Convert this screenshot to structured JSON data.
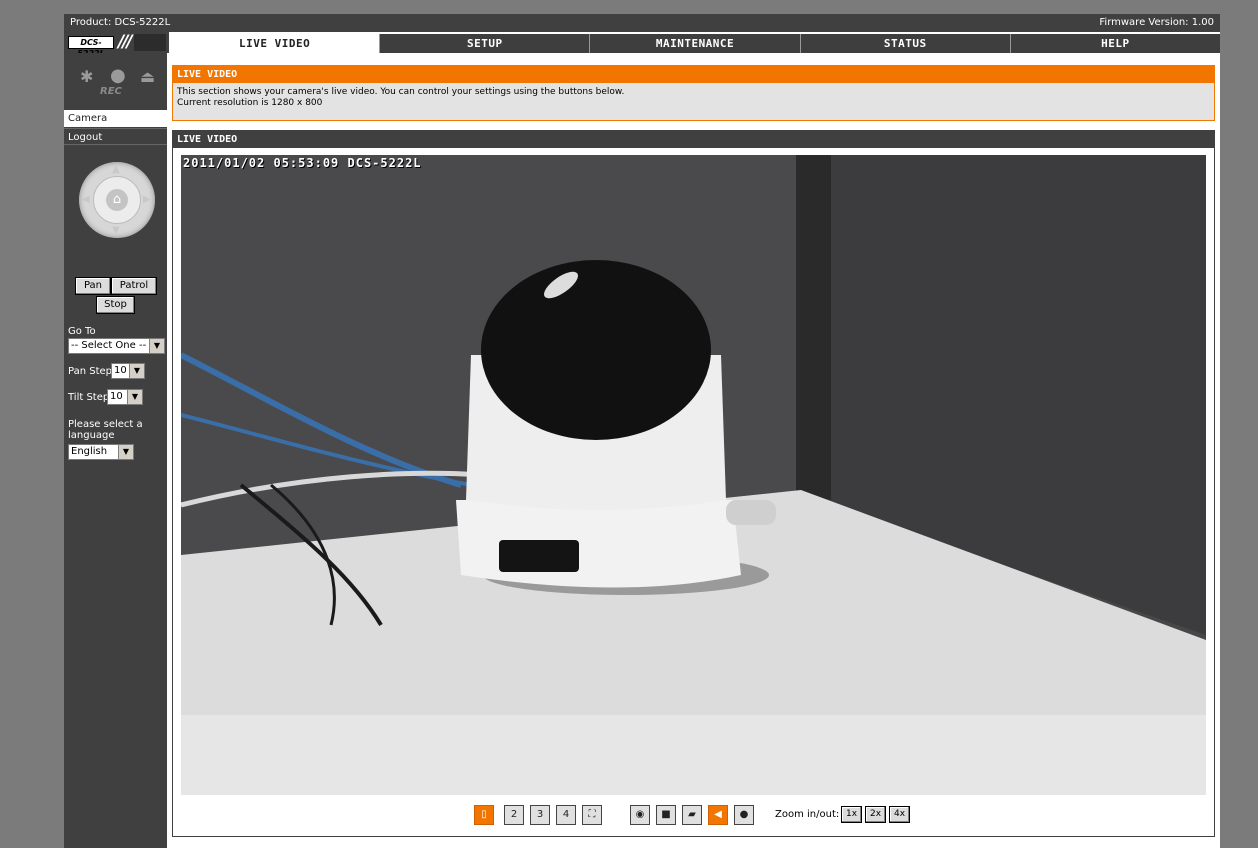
{
  "header": {
    "product": "Product: DCS-5222L",
    "firmware": "Firmware Version: 1.00",
    "logo_text": "DCS-5222L"
  },
  "nav": {
    "tabs": [
      {
        "label": "LIVE VIDEO",
        "active": true
      },
      {
        "label": "SETUP",
        "active": false
      },
      {
        "label": "MAINTENANCE",
        "active": false
      },
      {
        "label": "STATUS",
        "active": false
      },
      {
        "label": "HELP",
        "active": false
      }
    ]
  },
  "sidebar": {
    "rec_label": "REC",
    "menu": [
      {
        "label": "Camera"
      },
      {
        "label": "Logout"
      }
    ],
    "ptz": {
      "pan_label": "Pan",
      "patrol_label": "Patrol",
      "stop_label": "Stop"
    },
    "goto_label": "Go To",
    "goto_value": "-- Select One --",
    "pan_step_label": "Pan Step",
    "pan_step_value": "10",
    "tilt_step_label": "Tilt Step",
    "tilt_step_value": "10",
    "language_label": "Please select a language",
    "language_value": "English"
  },
  "info": {
    "title": "LIVE VIDEO",
    "line1": "This section shows your camera's live video. You can control your settings using the buttons below.",
    "line2": "Current resolution is 1280 x 800"
  },
  "live": {
    "title": "LIVE VIDEO",
    "osd": "2011/01/02 05:53:09 DCS-5222L",
    "zoom_label": "Zoom in/out:",
    "zoom_options": [
      "1x",
      "2x",
      "4x"
    ],
    "toolbar_icons": [
      "layout-1-icon",
      "layout-2-icon",
      "layout-3-icon",
      "layout-4-icon",
      "fullscreen-icon",
      "snapshot-icon",
      "record-icon",
      "folder-icon",
      "speaker-icon",
      "microphone-icon"
    ]
  },
  "colors": {
    "accent": "#f27500",
    "dark": "#404040",
    "background": "#7b7b7b"
  }
}
